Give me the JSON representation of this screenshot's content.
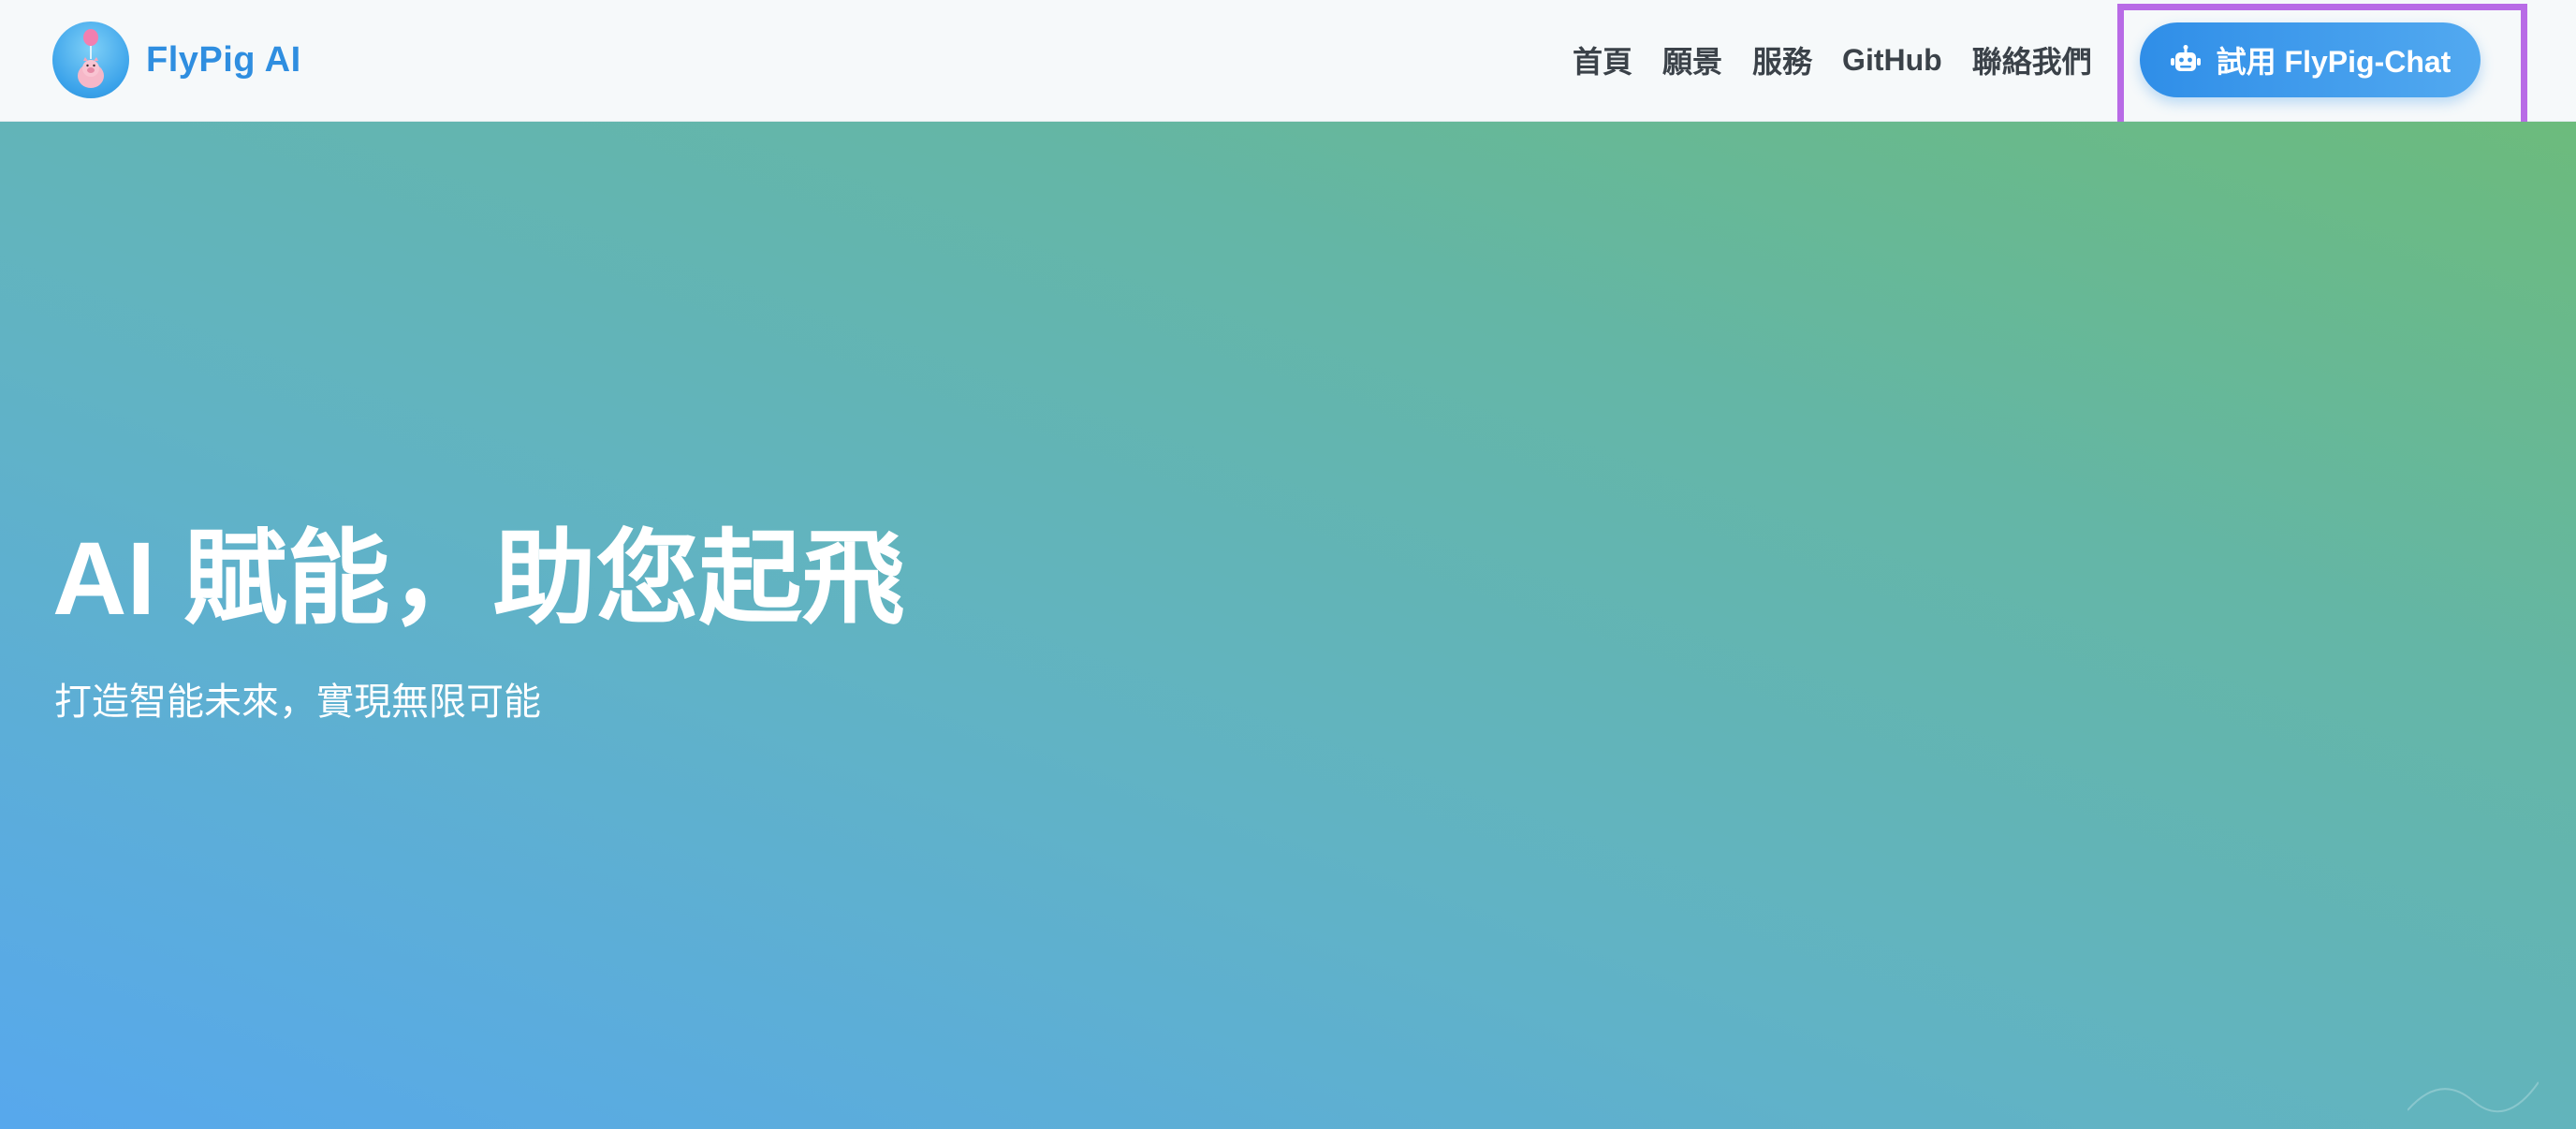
{
  "header": {
    "brand": {
      "name": "FlyPig AI",
      "logo_icon": "flypig-balloon-logo"
    },
    "nav": [
      {
        "label": "首頁"
      },
      {
        "label": "願景"
      },
      {
        "label": "服務"
      },
      {
        "label": "GitHub"
      },
      {
        "label": "聯絡我們"
      }
    ],
    "cta": {
      "label": "試用 FlyPig-Chat",
      "icon": "robot-icon",
      "highlighted": true
    }
  },
  "hero": {
    "title": "AI 賦能，助您起飛",
    "subtitle": "打造智能未來，實現無限可能"
  },
  "colors": {
    "brand": "#2f8ee0",
    "cta_gradient_start": "#2f8ee8",
    "cta_gradient_end": "#52a9f0",
    "highlight_frame": "#b86be6",
    "hero_gradient_start": "#57a8ed",
    "hero_gradient_end": "#6cbb7c",
    "nav_text": "#3b4249"
  }
}
